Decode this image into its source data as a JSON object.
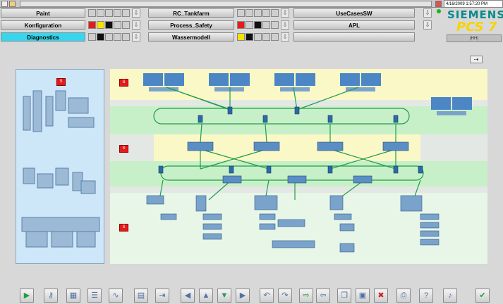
{
  "header": {
    "timestamp": "4/16/2009 1:57:20 PM",
    "user_field": "(HH)"
  },
  "areas": [
    {
      "label": "Paint",
      "active": false
    },
    {
      "label": "Konfiguration",
      "active": false
    },
    {
      "label": "Diagnostics",
      "active": true
    },
    {
      "label": "RC_Tankfarm",
      "active": false
    },
    {
      "label": "Process_Safety",
      "active": false
    },
    {
      "label": "Wassermodell",
      "active": false
    },
    {
      "label": "UseCasesSW",
      "active": false
    },
    {
      "label": "APL",
      "active": false
    }
  ],
  "logo": {
    "brand": "SIEMENS",
    "product": "PCS 7"
  },
  "zones": [
    {
      "label": "S"
    },
    {
      "label": "S"
    },
    {
      "label": "S"
    }
  ],
  "left_panel": {
    "label": "S"
  },
  "toolbar": {
    "icons": [
      "play-icon",
      "key-icon",
      "grid-icon",
      "list-icon",
      "trend-icon",
      "report-icon",
      "export-icon",
      "arrow-left-icon",
      "arrow-up-icon",
      "arrow-down-icon",
      "arrow-right-icon",
      "undo-icon",
      "redo-icon",
      "next-icon",
      "prev-icon",
      "copy-icon",
      "save-icon",
      "delete-icon",
      "print-icon",
      "help-icon",
      "sound-icon",
      "ack-icon"
    ]
  },
  "colors": {
    "active_area": "#36d6ee",
    "alarm": "#e41c1c",
    "warning": "#f7e000",
    "net": "#1f9e4a"
  }
}
